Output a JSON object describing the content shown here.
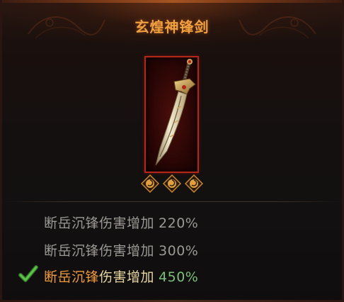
{
  "item": {
    "name": "玄煌神锋剑",
    "title_color": "#f0a040",
    "frame_color": "#b3261a"
  },
  "sockets": [
    {
      "icon": "swirl-gem-icon"
    },
    {
      "icon": "swirl-gem-icon"
    },
    {
      "icon": "swirl-gem-icon"
    }
  ],
  "effects": [
    {
      "name_part1": "断岳沉锋",
      "name_part2": "伤害增加",
      "value": "220%",
      "active": false
    },
    {
      "name_part1": "断岳沉锋",
      "name_part2": "伤害增加",
      "value": "300%",
      "active": false
    },
    {
      "name_part1": "断岳沉锋",
      "name_part2": "伤害增加",
      "value": "450%",
      "active": true
    }
  ],
  "colors": {
    "inactive_text": "#9c9894",
    "active_name": "#ef9a3c",
    "active_desc": "#e6d6a0",
    "active_value": "#7bc07a",
    "checkmark": "#4caf3c"
  }
}
